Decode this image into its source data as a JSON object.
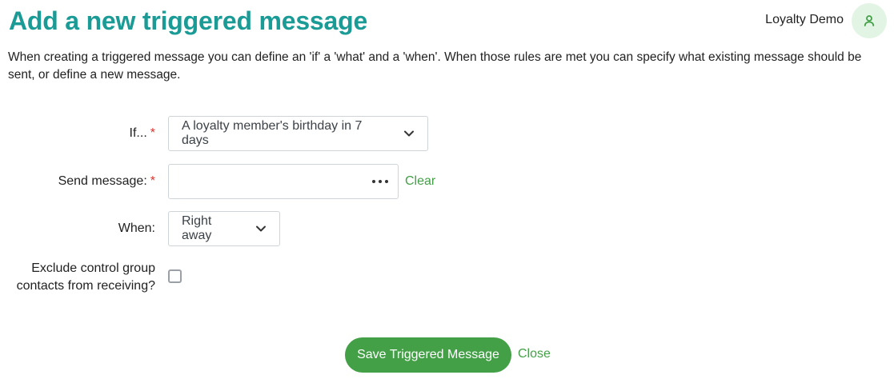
{
  "header": {
    "title": "Add a new triggered message",
    "user_name": "Loyalty Demo",
    "avatar_icon": "user-icon"
  },
  "intro_text": "When creating a triggered message you can define an 'if' a 'what' and a 'when'. When those rules are met you can specify what existing message should be sent, or define a new message.",
  "form": {
    "if": {
      "label": "If...",
      "required_mark": "*",
      "selected": "A loyalty member's birthday in 7 days",
      "icon": "chevron-down-icon"
    },
    "send_message": {
      "label": "Send message:",
      "required_mark": "*",
      "value": "",
      "picker_icon": "more-horizontal-icon",
      "clear_label": "Clear"
    },
    "when": {
      "label": "When:",
      "selected": "Right away",
      "icon": "chevron-down-icon"
    },
    "exclude_control": {
      "label_line1": "Exclude control group",
      "label_line2": "contacts from receiving?",
      "checked": false
    }
  },
  "actions": {
    "save_label": "Save Triggered Message",
    "close_label": "Close"
  },
  "colors": {
    "title": "#1a9b96",
    "accent_green": "#43a047",
    "required": "#d9332e",
    "avatar_bg": "#e2f4e4"
  }
}
